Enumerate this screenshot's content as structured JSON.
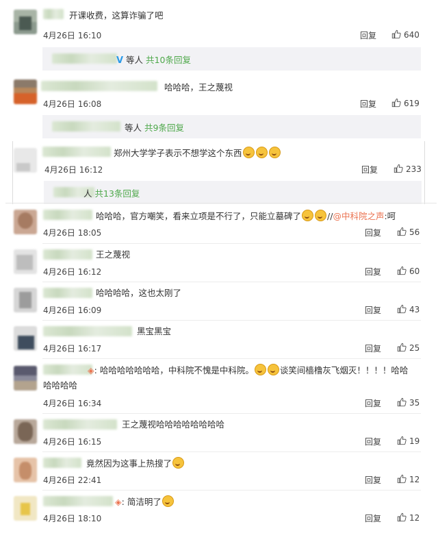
{
  "comments": [
    {
      "text": "开课收费，这算诈骗了吧",
      "time": "4月26日 16:10",
      "reply": "回复",
      "likes": "640"
    },
    {
      "text": "哈哈哈，王之蔑视",
      "time": "4月26日 16:08",
      "reply": "回复",
      "likes": "619"
    },
    {
      "text": "郑州大学学子表示不想学这个东西",
      "time": "4月26日 16:12",
      "reply": "回复",
      "likes": "233"
    },
    {
      "text": "哈哈哈，官方嘲笑，看来立项是不行了，只能立墓碑了",
      "text_tail": "//",
      "mention": "@中科院之声",
      "text_after": ":呵",
      "time": "4月26日 18:05",
      "reply": "回复",
      "likes": "56"
    },
    {
      "text": "王之蔑视",
      "time": "4月26日 16:12",
      "reply": "回复",
      "likes": "60"
    },
    {
      "text": "哈哈哈哈，这也太刚了",
      "time": "4月26日 16:09",
      "reply": "回复",
      "likes": "43"
    },
    {
      "text": "黑宝黑宝",
      "time": "4月26日 16:17",
      "reply": "回复",
      "likes": "25"
    },
    {
      "text_line1": "哈哈哈哈哈哈哈，中科院不愧是中科院。",
      "text_line1b": "谈笑间樯橹灰飞烟灭！！！！哈哈",
      "text_line2": "哈哈哈哈",
      "time": "4月26日 16:34",
      "reply": "回复",
      "likes": "35"
    },
    {
      "text": "王之蔑视哈哈哈哈哈哈哈哈",
      "time": "4月26日 16:15",
      "reply": "回复",
      "likes": "19"
    },
    {
      "text": "竟然因为这事上热搜了",
      "time": "4月26日 22:41",
      "reply": "回复",
      "likes": "12"
    },
    {
      "text": "简洁明了",
      "time": "4月26日 18:10",
      "reply": "回复",
      "likes": "12"
    }
  ],
  "subreplies": [
    {
      "suffix": "等人",
      "count": "共10条回复"
    },
    {
      "suffix": "等人",
      "count": "共9条回复"
    },
    {
      "suffix": "人",
      "count": "共13条回复"
    }
  ],
  "colors": {
    "accent_green": "#4ea84a",
    "mention": "#eb7350",
    "sub_bg": "#f2f2f5"
  },
  "icons": {
    "like": "thumbs-up-icon",
    "emoji": "laughing-emoji-icon"
  }
}
